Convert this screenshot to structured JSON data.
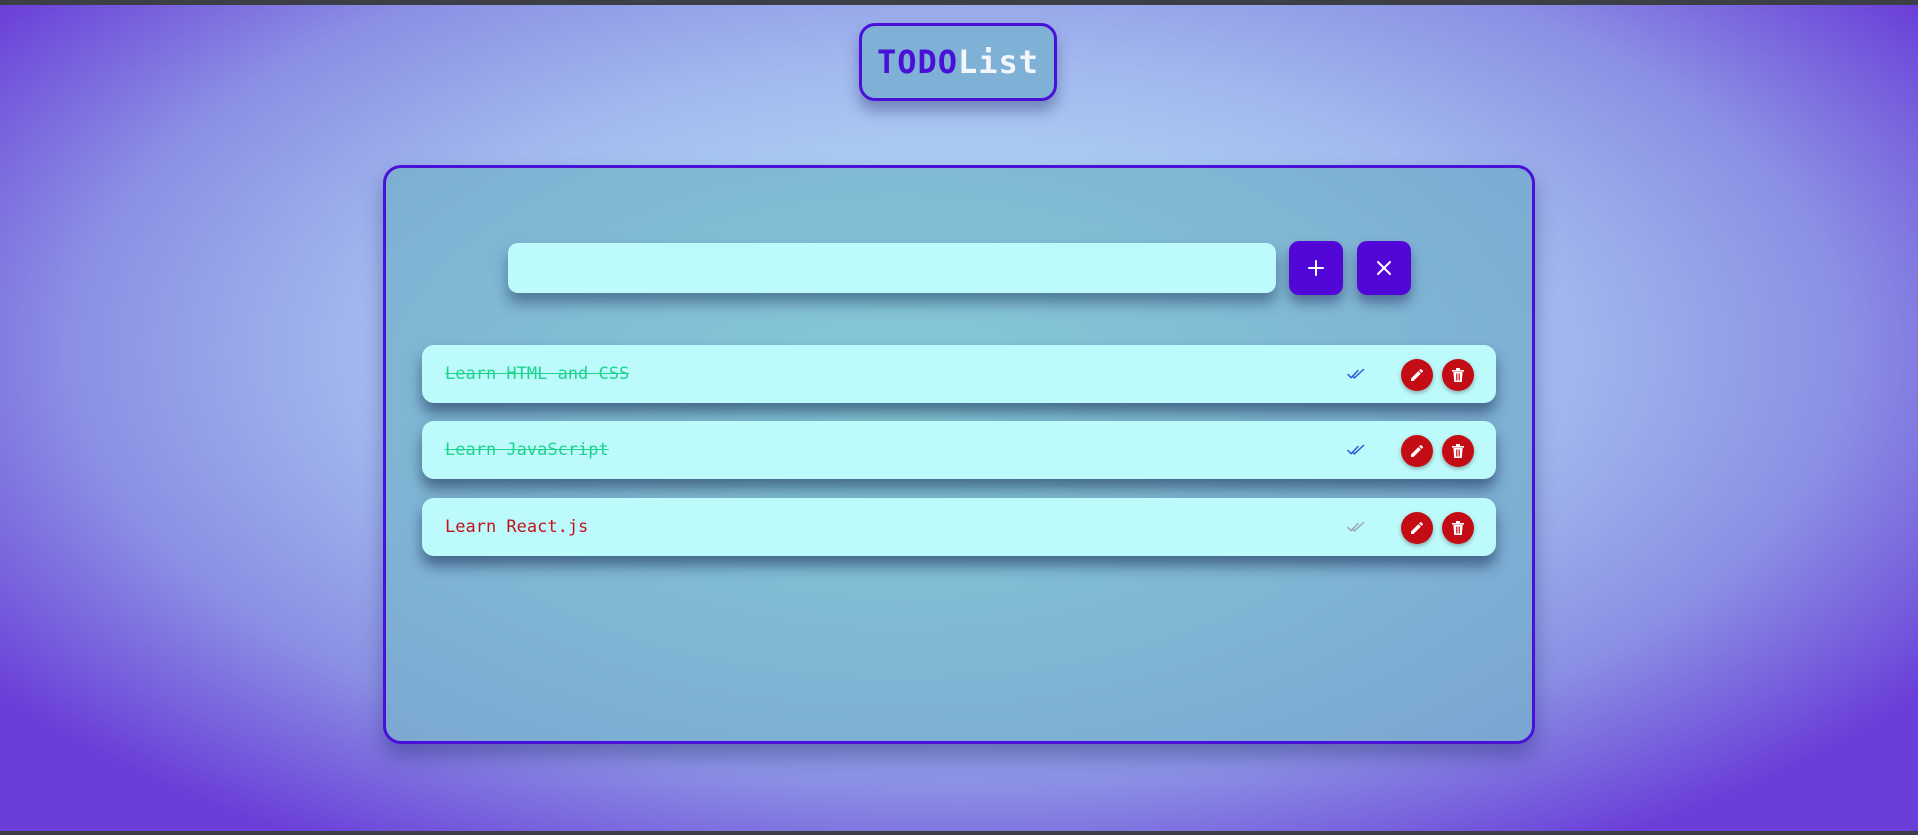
{
  "header": {
    "title_part1": "TODO",
    "title_part2": "List"
  },
  "input": {
    "value": "",
    "placeholder": ""
  },
  "buttons": {
    "add_icon": "plus-icon",
    "clear_icon": "close-icon"
  },
  "todos": [
    {
      "text": "Learn HTML and CSS",
      "completed": true
    },
    {
      "text": "Learn JavaScript",
      "completed": true
    },
    {
      "text": "Learn React.js",
      "completed": false
    }
  ],
  "colors": {
    "accent": "#5206d8",
    "danger": "#c40c14",
    "completed_text": "#1ed48c",
    "pending_text": "#c0141c",
    "check_done": "#2b5cd8",
    "check_pending": "#9aa4b4",
    "item_bg": "#bdfafb"
  }
}
